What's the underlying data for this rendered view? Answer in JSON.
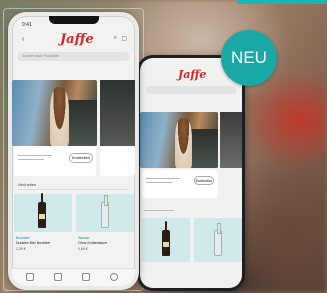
{
  "badge": {
    "label": "NEU",
    "color": "#1aa8a6"
  },
  "brand": {
    "logo": "Jaffe",
    "color": "#d3262b"
  },
  "front_phone": {
    "time": "9:41",
    "nav_icon": "chevron-left-icon",
    "right_icons": [
      "search-icon",
      "cart-icon"
    ],
    "search_placeholder": "Suchen nach Produkten",
    "promo_button": "Entdecken",
    "section_title": "Neuheiten",
    "products": [
      {
        "name": "Bockbier",
        "subtitle": "Dunkles Bier Bockbier",
        "price": "2,39 €"
      },
      {
        "name": "Wasser",
        "subtitle": "Ohne Kohlensäure",
        "price": "0,69 €"
      }
    ],
    "tabs": [
      "home-icon",
      "search-icon",
      "cart-icon",
      "profile-icon"
    ]
  },
  "back_phone": {
    "header": "Jaffe",
    "promo_button": "Entdecken"
  }
}
